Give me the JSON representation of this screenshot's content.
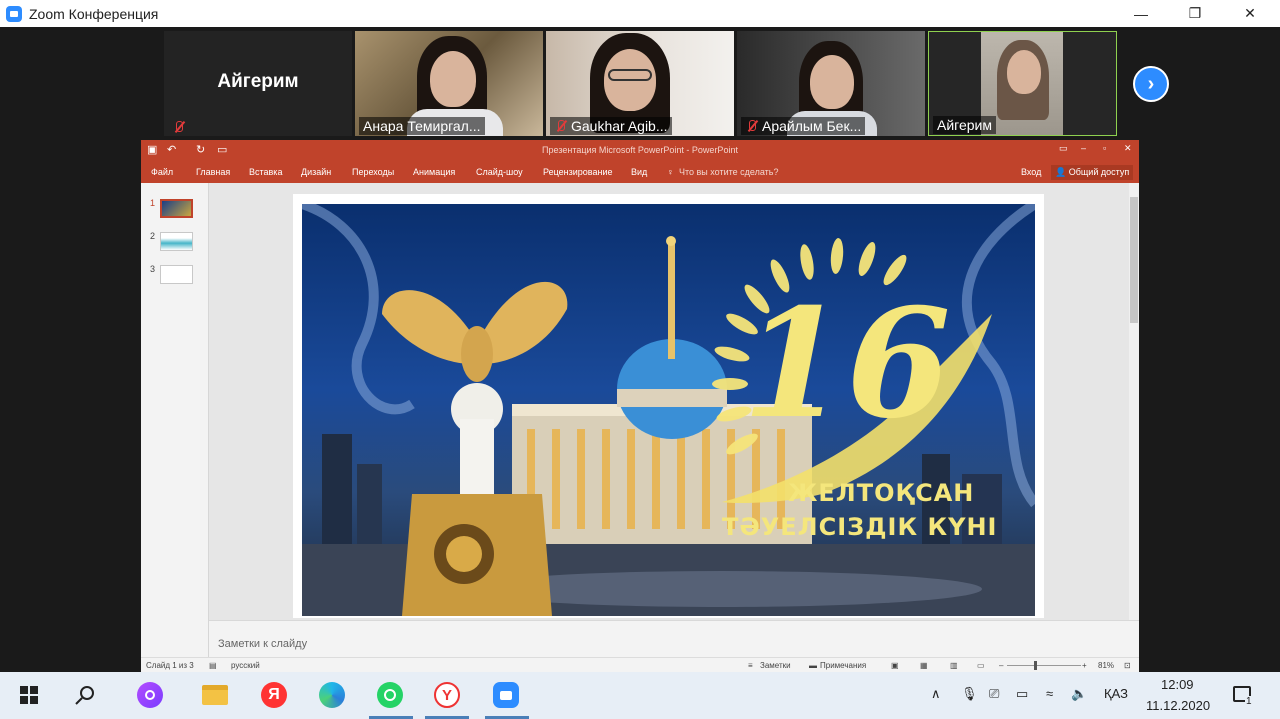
{
  "zoom": {
    "window_title": "Zoom Конференция",
    "controls": {
      "minimize": "—",
      "restore": "❐",
      "close": "✕"
    },
    "participants": [
      {
        "name": "Айгерим",
        "type": "no-video",
        "muted": true
      },
      {
        "name": "Анара Темиргал...",
        "type": "video",
        "muted": false
      },
      {
        "name": "Gaukhar Agib...",
        "type": "video",
        "muted": true
      },
      {
        "name": "Арайлым Бек...",
        "type": "video",
        "muted": true
      },
      {
        "name": "Айгерим",
        "type": "video",
        "muted": false,
        "active_speaker": true
      }
    ],
    "next_page": "›"
  },
  "powerpoint": {
    "window_title": "Презентация Microsoft PowerPoint - PowerPoint",
    "ribbon_tabs": [
      "Файл",
      "Главная",
      "Вставка",
      "Дизайн",
      "Переходы",
      "Анимация",
      "Слайд-шоу",
      "Рецензирование",
      "Вид"
    ],
    "tell_me": "Что вы хотите сделать?",
    "sign_in": "Вход",
    "share": "Общий доступ",
    "thumbnails": [
      "1",
      "2",
      "3"
    ],
    "slide": {
      "number": "16",
      "line1": "ЖЕЛТОҚСАН",
      "line2": "ТӘУЕЛСІЗДІК КҮНІ"
    },
    "notes_placeholder": "Заметки к слайду",
    "status": {
      "slide_counter": "Слайд 1 из 3",
      "language": "русский",
      "notes": "Заметки",
      "comments": "Примечания",
      "zoom": "81%"
    }
  },
  "taskbar": {
    "tray_lang": "ҚАЗ",
    "time": "12:09",
    "date": "11.12.2020",
    "notification_count": "1"
  },
  "colors": {
    "ppt_accent": "#c0432b",
    "zoom_blue": "#2d8cff",
    "active_speaker_border": "#8fd14f"
  }
}
